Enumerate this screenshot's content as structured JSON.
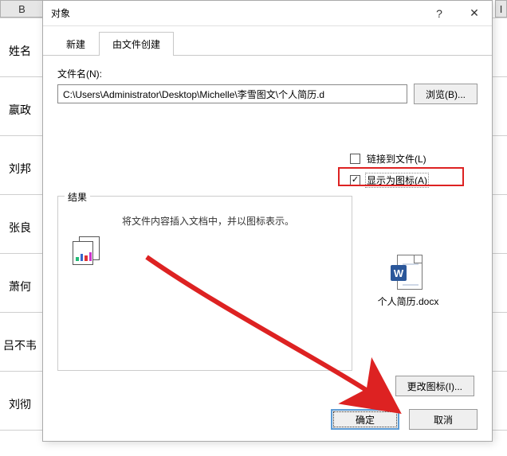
{
  "sheet": {
    "col_b": "B",
    "col_i": "I",
    "rows": [
      "姓名",
      "嬴政",
      "刘邦",
      "张良",
      "萧何",
      "吕不韦",
      "刘彻"
    ]
  },
  "dialog": {
    "title": "对象",
    "help_hint": "?",
    "close_hint": "✕",
    "tabs": {
      "new": "新建",
      "from_file": "由文件创建"
    },
    "filename_label": "文件名(N):",
    "filename_value": "C:\\Users\\Administrator\\Desktop\\Michelle\\李雪图文\\个人简历.d",
    "browse": "浏览(B)...",
    "link_to_file": "链接到文件(L)",
    "link_checked": false,
    "show_as_icon": "显示为图标(A)",
    "icon_checked": true,
    "result_legend": "结果",
    "result_text": "将文件内容插入文档中，并以图标表示。",
    "preview_filename": "个人简历.docx",
    "change_icon": "更改图标(I)...",
    "ok": "确定",
    "cancel": "取消"
  }
}
